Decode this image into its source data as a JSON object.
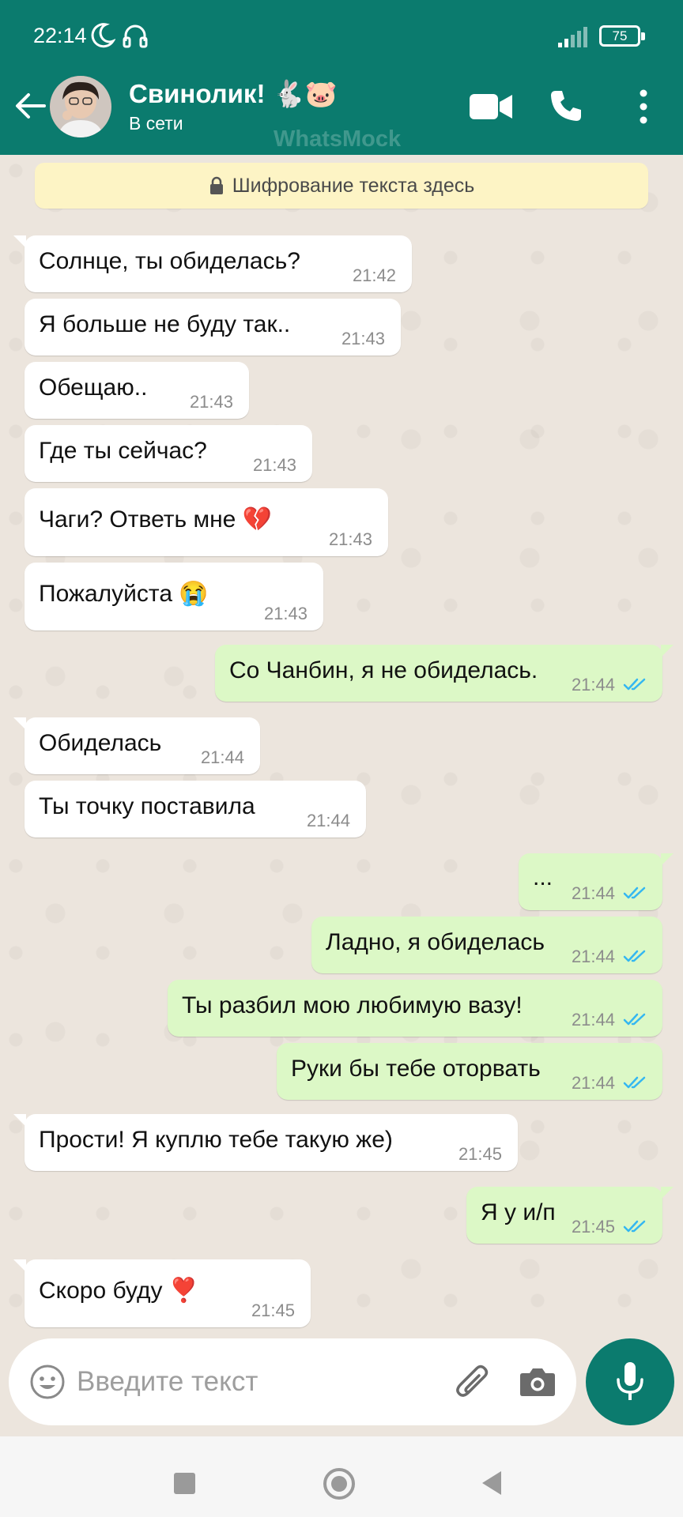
{
  "status_bar": {
    "time": "22:14",
    "battery": "75"
  },
  "header": {
    "contact_name": "Свинолик! 🐇🐷",
    "contact_status": "В сети",
    "watermark": "WhatsMock",
    "icons": [
      "back-arrow-icon",
      "video-call-icon",
      "phone-icon",
      "more-vert-icon"
    ]
  },
  "chat": {
    "encryption_notice": "Шифрование текста здесь",
    "messages": [
      {
        "dir": "in",
        "text": "Солнце, ты обиделась?",
        "time": "21:42"
      },
      {
        "dir": "in",
        "text": "Я больше не буду так..",
        "time": "21:43"
      },
      {
        "dir": "in",
        "text": "Обещаю..",
        "time": "21:43"
      },
      {
        "dir": "in",
        "text": "Где ты сейчас?",
        "time": "21:43"
      },
      {
        "dir": "in",
        "text": "Чаги? Ответь мне 💔",
        "time": "21:43"
      },
      {
        "dir": "in",
        "text": "Пожалуйста 😭",
        "time": "21:43"
      },
      {
        "dir": "out",
        "text": "Со Чанбин, я не обиделась.",
        "time": "21:44",
        "read": true
      },
      {
        "dir": "in",
        "text": "Обиделась",
        "time": "21:44"
      },
      {
        "dir": "in",
        "text": "Ты точку поставила",
        "time": "21:44"
      },
      {
        "dir": "out",
        "text": "...",
        "time": "21:44",
        "read": true
      },
      {
        "dir": "out",
        "text": "Ладно, я обиделась",
        "time": "21:44",
        "read": true
      },
      {
        "dir": "out",
        "text": "Ты разбил мою любимую вазу!",
        "time": "21:44",
        "read": true
      },
      {
        "dir": "out",
        "text": "Руки бы тебе оторвать",
        "time": "21:44",
        "read": true
      },
      {
        "dir": "in",
        "text": "Прости! Я куплю тебе такую же)",
        "time": "21:45"
      },
      {
        "dir": "out",
        "text": "Я у и/п",
        "time": "21:45",
        "read": true
      },
      {
        "dir": "in",
        "text": "Скоро буду ❣️",
        "time": "21:45"
      }
    ]
  },
  "input": {
    "placeholder": "Введите текст"
  },
  "colors": {
    "header": "#0b7b6e",
    "outgoing": "#dcf8c6",
    "incoming": "#ffffff",
    "read_ticks": "#34b7f1"
  }
}
